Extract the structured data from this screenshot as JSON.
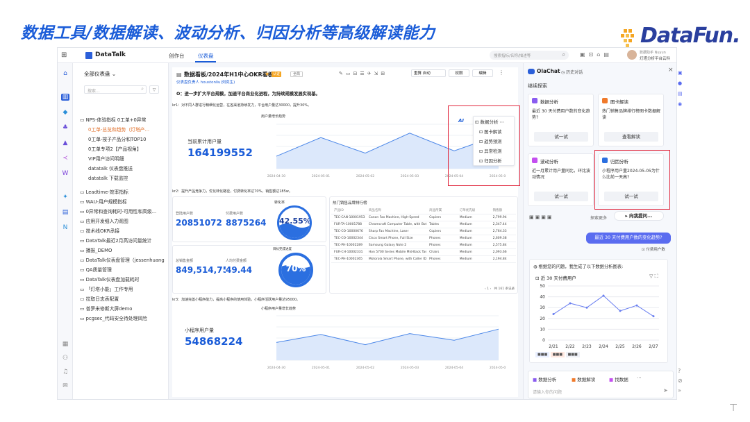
{
  "slide": {
    "title": "数据工具/数据解读、波动分析、归因分析等高级解读能力",
    "logo_text": "DataFun."
  },
  "header": {
    "brand": "DataTalk",
    "tabs": [
      "创作台",
      "仪表盘"
    ],
    "search_placeholder": "搜索指标/名称/描述等",
    "user_name": "数据助手 Nuyun",
    "user_org": "灯塔分析平台云科"
  },
  "left_panel": {
    "title": "全部仪表盘",
    "search_placeholder": "搜索...",
    "items": [
      "NPS-体验指标 0工单+0异常",
      "0工单-总览和趋势（灯塔产...",
      "0工单-按子产品分和TOP10",
      "0工单专项2【产品视角】",
      "VIP用户访问明细",
      "datatalk 仪表盘推送",
      "datatalk 下载监控",
      "Leadtime-效率指标",
      "WAU-用户规模指标",
      "0异常和查询耗时-可用性和高级...",
      "应用开发细入力观图",
      "技术线OKR承接",
      "DataTalk最近2月高访问量统计",
      "播报_DEMO",
      "DataTalk仪表盘管理（jessenhuang",
      "QA质量管理",
      "DataTalk仪表盘加载耗时",
      "「灯塔小能」工作专用",
      "拉取日志表配置",
      "普罗米修斯大屏demo",
      "pcgsec_代码安全待处理风险"
    ]
  },
  "dashboard": {
    "title": "数据看板/2024年H1中心OKR看板",
    "badge": "认证",
    "tag": "全局",
    "owner": "仪表盘负责人 houstonliu(刘奕生)",
    "toolbar": [
      "重算",
      "自动",
      "权限",
      "编辑"
    ],
    "objective": "O：进一步扩大平台规模，加速平台商业化进程，为持续规模发展实现基。",
    "kr1": "kr1：对不同人群进行精细化运营，在各渠道持续发力，平台用户量达30000，提升30%。",
    "kr2": "kr2：提升产品竞争力，优化转化路径，付费转化率达70%，销售额达185w。",
    "kr3": "kr3：加速完善小程序能力，提高小程序的使用体验，小程序活跃用户量达95000。",
    "chart1_title": "用户量增长趋势",
    "cumulative_label": "当前累计用户量",
    "cumulative_value": "164199552",
    "ai_menu_title": "数据分析",
    "ai_menu_items": [
      "图卡解读",
      "趋势预测",
      "异常检测",
      "归因分析"
    ],
    "conv_title": "转化率",
    "reg_label": "登陆用户数",
    "reg_value": "20851072",
    "paid_label": "付费用户数",
    "paid_value": "8875264",
    "conv_rate": "42.55%",
    "target_title": "目标完成进度",
    "sales_label": "总销售金额",
    "sales_value": "849,514,75:",
    "qty_label": "人均付费金额",
    "qty_value": "49.44",
    "target_rate": "70%",
    "table_title": "热门销售品牌排行榜",
    "table_headers": [
      "产品ID",
      "商品名称",
      "商品所属",
      "订单优先级",
      "销售额"
    ],
    "table_rows": [
      [
        "TEC-CAN-10001953",
        "Canon Fax Machine, High-Speed",
        "Copiers",
        "Medium",
        "2,799.94"
      ],
      [
        "FUR-TA-10001788",
        "Chromcraft Computer Table, with Bottom Storage",
        "Tables",
        "Medium",
        "2,347.44"
      ],
      [
        "TEC-CO-10000676",
        "Sharp Fax Machine, Laser",
        "Copiers",
        "Medium",
        "2,764.33"
      ],
      [
        "TEC-CO-10002344",
        "Cisco Smart Phone, Full Size",
        "Phones",
        "Medium",
        "2,609.38"
      ],
      [
        "TEC-PH-10002289",
        "Samsung Galaxy Note 2",
        "Phones",
        "Medium",
        "2,575.84"
      ],
      [
        "FUR-CH-10002331",
        "Hon 5700 Series Mobile Mid-Back Task Chairs with Adjustable Arms",
        "Chairs",
        "Medium",
        "2,093.66"
      ],
      [
        "TEC-PH-10002365",
        "Motorola Smart Phone, with Caller ID",
        "Phones",
        "Medium",
        "2,194.84"
      ]
    ],
    "pagination": "共 161 条记录",
    "chart3_title": "小程序用户量增长趋势",
    "mini_label": "小程序用户量",
    "mini_value": "54868224"
  },
  "olachat": {
    "title": "OlaChat",
    "history": "历史对话",
    "section": "继续探索",
    "cards": [
      {
        "name": "数据分析",
        "text": "最近 30 天付费用户数的变化趋势?",
        "button": "试一试"
      },
      {
        "name": "图卡解读",
        "text": "热门销售品牌排行榜图卡数据解读",
        "button": "查看解读"
      },
      {
        "name": "波动分析",
        "text": "近一月累计用户量同比，环比波动情况",
        "button": "试一试"
      },
      {
        "name": "归因分析",
        "text": "小程序用户量2024-05-05为什么比前一天高?",
        "button": "试一试"
      }
    ],
    "explore_more": "探索更多",
    "ask_me": "向我提问...",
    "user_question": "最近 30 天付费用户数的变化趋势?",
    "kb_label": "付费用户数",
    "answer_intro": "根据您的问题，我生成了以下数据分析图表:",
    "chart_title": "近 30 天付费用户",
    "quick_actions": [
      "数据分析",
      "数据解读",
      "找数据"
    ],
    "input_placeholder": "请输入你的问题"
  },
  "chart_data": [
    {
      "type": "line",
      "title": "近 30 天付费用户",
      "categories": [
        "2/21",
        "2/22",
        "2/23",
        "2/24",
        "2/25",
        "2/26",
        "2/27"
      ],
      "values": [
        24,
        34,
        30,
        41,
        27,
        32,
        22
      ],
      "ylim": [
        0,
        50
      ],
      "yticks": [
        0,
        10,
        20,
        30,
        40,
        50
      ]
    },
    {
      "type": "area",
      "title": "用户量增长趋势",
      "categories": [
        "2024-04-30",
        "2024-05-01",
        "2024-05-02",
        "2024-05-03",
        "2024-05-04",
        "2024-05-05"
      ],
      "values": [
        28,
        70,
        35,
        80,
        40,
        75
      ]
    },
    {
      "type": "area",
      "title": "小程序用户量增长趋势",
      "categories": [
        "2024-04-30",
        "2024-05-01",
        "2024-05-02",
        "2024-05-03",
        "2024-05-04",
        "2024-05-05"
      ],
      "values": [
        40,
        58,
        35,
        60,
        45,
        70
      ]
    }
  ]
}
